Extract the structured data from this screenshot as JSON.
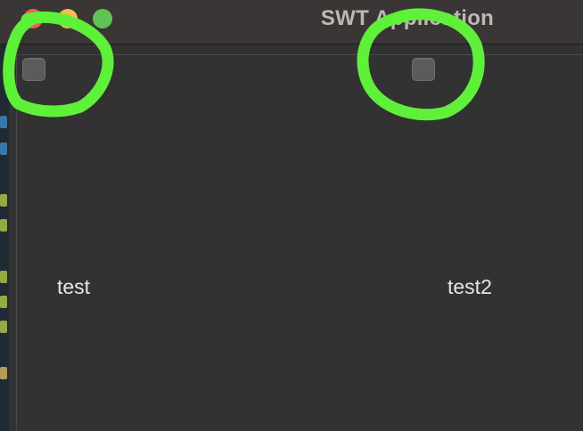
{
  "window": {
    "title": "SWT Application"
  },
  "controls": [
    {
      "label": "test",
      "checked": false
    },
    {
      "label": "test2",
      "checked": false
    }
  ],
  "annotation": {
    "color": "#5ff03a",
    "shape": "hand-drawn-circle"
  },
  "colors": {
    "window_bg": "#323232",
    "titlebar_bg": "#3a3635",
    "checkbox_bg": "#5b5b5b",
    "label_text": "#e6e6e6",
    "title_text": "#bdb8b5"
  }
}
